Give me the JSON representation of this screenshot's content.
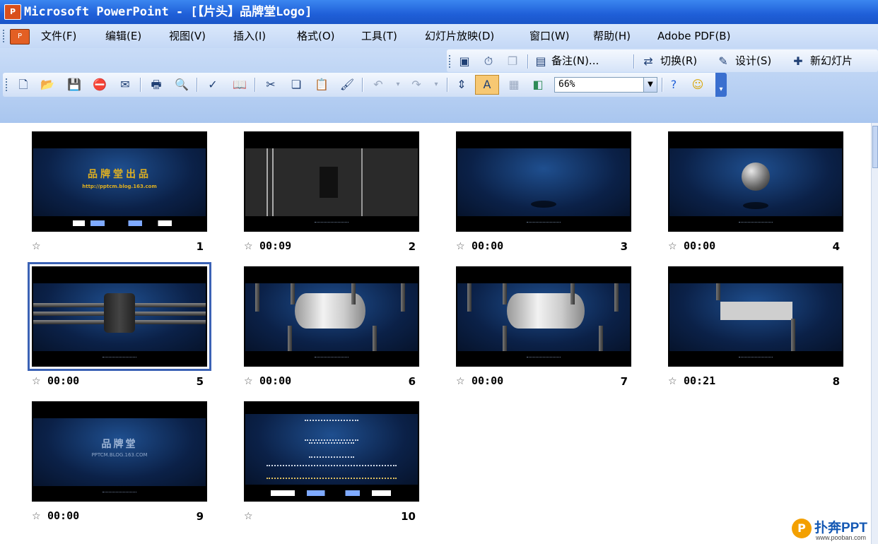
{
  "window": {
    "title": "Microsoft PowerPoint - [【片头】品牌堂Logo]",
    "app_icon": "P"
  },
  "menu": {
    "items": [
      "文件(F)",
      "编辑(E)",
      "视图(V)",
      "插入(I)",
      "格式(O)",
      "工具(T)",
      "幻灯片放映(D)",
      "窗口(W)",
      "帮助(H)",
      "Adobe PDF(B)"
    ]
  },
  "toolbar2": {
    "notes_label": "备注(N)...",
    "transition_label": "切换(R)",
    "design_label": "设计(S)",
    "new_slide_label": "新幻灯片"
  },
  "toolbar1": {
    "zoom_value": "66%"
  },
  "slides": [
    {
      "number": "1",
      "time": "",
      "line1": "品牌堂出品",
      "line2": "http://pptcm.blog.163.com"
    },
    {
      "number": "2",
      "time": "00:09"
    },
    {
      "number": "3",
      "time": "00:00"
    },
    {
      "number": "4",
      "time": "00:00"
    },
    {
      "number": "5",
      "time": "00:00",
      "selected": true
    },
    {
      "number": "6",
      "time": "00:00"
    },
    {
      "number": "7",
      "time": "00:00"
    },
    {
      "number": "8",
      "time": "00:21"
    },
    {
      "number": "9",
      "time": "00:00",
      "line1": "品牌堂",
      "line2": "PPTCM.BLOG.163.COM"
    },
    {
      "number": "10",
      "time": ""
    }
  ],
  "watermark": {
    "brand": "扑奔PPT",
    "url": "www.pooban.com"
  },
  "icons": {
    "star": "☆",
    "dropdown": "▼"
  }
}
